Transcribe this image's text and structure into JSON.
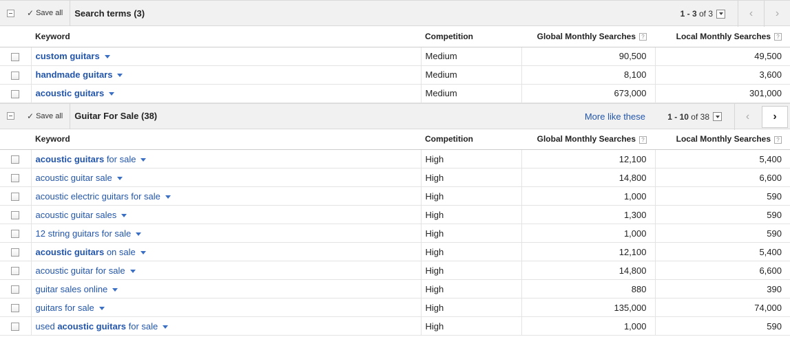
{
  "groups": [
    {
      "save_all": "Save all",
      "title": "Search terms (3)",
      "range_bold": "1 - 3",
      "range_rest": " of 3",
      "more_like": "",
      "prev_icon": "‹",
      "next_icon": "›",
      "columns": {
        "keyword": "Keyword",
        "competition": "Competition",
        "global": "Global Monthly Searches",
        "local": "Local Monthly Searches",
        "help": "?"
      },
      "rows": [
        {
          "kw_parts": [
            {
              "t": "custom guitars",
              "b": true
            }
          ],
          "competition": "Medium",
          "global": "90,500",
          "local": "49,500"
        },
        {
          "kw_parts": [
            {
              "t": "handmade guitars",
              "b": true
            }
          ],
          "competition": "Medium",
          "global": "8,100",
          "local": "3,600"
        },
        {
          "kw_parts": [
            {
              "t": "acoustic guitars",
              "b": true
            }
          ],
          "competition": "Medium",
          "global": "673,000",
          "local": "301,000"
        }
      ]
    },
    {
      "save_all": "Save all",
      "title": "Guitar For Sale (38)",
      "range_bold": "1 - 10",
      "range_rest": " of 38",
      "more_like": "More like these",
      "prev_icon": "‹",
      "next_icon": "›",
      "columns": {
        "keyword": "Keyword",
        "competition": "Competition",
        "global": "Global Monthly Searches",
        "local": "Local Monthly Searches",
        "help": "?"
      },
      "rows": [
        {
          "kw_parts": [
            {
              "t": "acoustic guitars",
              "b": true
            },
            {
              "t": " for sale",
              "b": false
            }
          ],
          "competition": "High",
          "global": "12,100",
          "local": "5,400"
        },
        {
          "kw_parts": [
            {
              "t": "acoustic guitar sale",
              "b": false
            }
          ],
          "competition": "High",
          "global": "14,800",
          "local": "6,600"
        },
        {
          "kw_parts": [
            {
              "t": "acoustic electric guitars for sale",
              "b": false
            }
          ],
          "competition": "High",
          "global": "1,000",
          "local": "590"
        },
        {
          "kw_parts": [
            {
              "t": "acoustic guitar sales",
              "b": false
            }
          ],
          "competition": "High",
          "global": "1,300",
          "local": "590"
        },
        {
          "kw_parts": [
            {
              "t": "12 string guitars for sale",
              "b": false
            }
          ],
          "competition": "High",
          "global": "1,000",
          "local": "590"
        },
        {
          "kw_parts": [
            {
              "t": "acoustic guitars",
              "b": true
            },
            {
              "t": " on sale",
              "b": false
            }
          ],
          "competition": "High",
          "global": "12,100",
          "local": "5,400"
        },
        {
          "kw_parts": [
            {
              "t": "acoustic guitar for sale",
              "b": false
            }
          ],
          "competition": "High",
          "global": "14,800",
          "local": "6,600"
        },
        {
          "kw_parts": [
            {
              "t": "guitar sales online",
              "b": false
            }
          ],
          "competition": "High",
          "global": "880",
          "local": "390"
        },
        {
          "kw_parts": [
            {
              "t": "guitars for sale",
              "b": false
            }
          ],
          "competition": "High",
          "global": "135,000",
          "local": "74,000"
        },
        {
          "kw_parts": [
            {
              "t": "used ",
              "b": false
            },
            {
              "t": "acoustic guitars",
              "b": true
            },
            {
              "t": " for sale",
              "b": false
            }
          ],
          "competition": "High",
          "global": "1,000",
          "local": "590"
        }
      ]
    }
  ]
}
